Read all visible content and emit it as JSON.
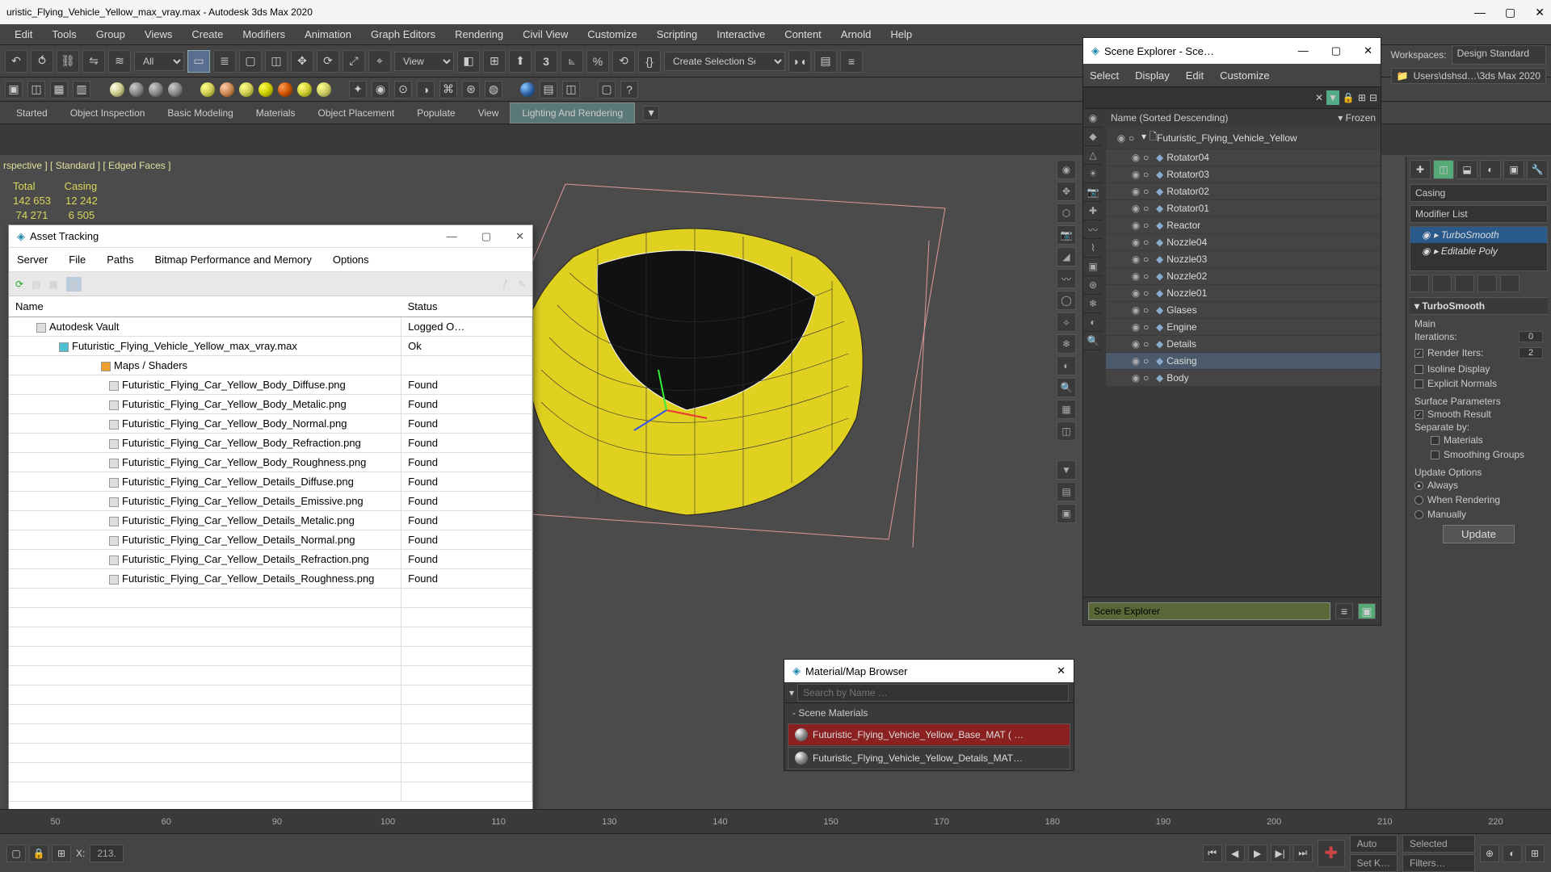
{
  "title_bar": "uristic_Flying_Vehicle_Yellow_max_vray.max - Autodesk 3ds Max 2020",
  "main_menu": [
    "Edit",
    "Tools",
    "Group",
    "Views",
    "Create",
    "Modifiers",
    "Animation",
    "Graph Editors",
    "Rendering",
    "Civil View",
    "Customize",
    "Scripting",
    "Interactive",
    "Content",
    "Arnold",
    "Help"
  ],
  "toolbar1": {
    "filter_drop": "All",
    "view_drop": "View",
    "selset_drop": "Create Selection Set"
  },
  "ribbon_tabs": [
    "Started",
    "Object Inspection",
    "Basic Modeling",
    "Materials",
    "Object Placement",
    "Populate",
    "View",
    "Lighting And Rendering"
  ],
  "ribbon_active": 7,
  "workspaces_label": "Workspaces:",
  "workspaces_value": "Design Standard",
  "path_bar": "Users\\dshsd…\\3ds Max 2020",
  "viewport": {
    "label": "rspective ] [ Standard ] [ Edged Faces ]",
    "stats_header": "Total          Casing",
    "stats_l1": "142 653     12 242",
    "stats_l2": " 74 271       6 505"
  },
  "asset_tracking": {
    "title": "Asset Tracking",
    "menu": [
      "Server",
      "File",
      "Paths",
      "Bitmap Performance and Memory",
      "Options"
    ],
    "col_name": "Name",
    "col_status": "Status",
    "rows": [
      {
        "indent": "indent1",
        "text": "Autodesk Vault",
        "status": "Logged O…",
        "ico": ""
      },
      {
        "indent": "indent2",
        "text": "Futuristic_Flying_Vehicle_Yellow_max_vray.max",
        "status": "Ok",
        "ico": "cyan"
      },
      {
        "indent": "indent3",
        "text": "Maps / Shaders",
        "status": "",
        "ico": "orange"
      },
      {
        "indent": "indent4",
        "text": "Futuristic_Flying_Car_Yellow_Body_Diffuse.png",
        "status": "Found",
        "ico": ""
      },
      {
        "indent": "indent4",
        "text": "Futuristic_Flying_Car_Yellow_Body_Metalic.png",
        "status": "Found",
        "ico": ""
      },
      {
        "indent": "indent4",
        "text": "Futuristic_Flying_Car_Yellow_Body_Normal.png",
        "status": "Found",
        "ico": ""
      },
      {
        "indent": "indent4",
        "text": "Futuristic_Flying_Car_Yellow_Body_Refraction.png",
        "status": "Found",
        "ico": ""
      },
      {
        "indent": "indent4",
        "text": "Futuristic_Flying_Car_Yellow_Body_Roughness.png",
        "status": "Found",
        "ico": ""
      },
      {
        "indent": "indent4",
        "text": "Futuristic_Flying_Car_Yellow_Details_Diffuse.png",
        "status": "Found",
        "ico": ""
      },
      {
        "indent": "indent4",
        "text": "Futuristic_Flying_Car_Yellow_Details_Emissive.png",
        "status": "Found",
        "ico": ""
      },
      {
        "indent": "indent4",
        "text": "Futuristic_Flying_Car_Yellow_Details_Metalic.png",
        "status": "Found",
        "ico": ""
      },
      {
        "indent": "indent4",
        "text": "Futuristic_Flying_Car_Yellow_Details_Normal.png",
        "status": "Found",
        "ico": ""
      },
      {
        "indent": "indent4",
        "text": "Futuristic_Flying_Car_Yellow_Details_Refraction.png",
        "status": "Found",
        "ico": ""
      },
      {
        "indent": "indent4",
        "text": "Futuristic_Flying_Car_Yellow_Details_Roughness.png",
        "status": "Found",
        "ico": ""
      }
    ]
  },
  "scene_explorer": {
    "title": "Scene Explorer - Sce…",
    "menu": [
      "Select",
      "Display",
      "Edit",
      "Customize"
    ],
    "header_name": "Name (Sorted Descending)",
    "header_frozen": "▾ Frozen",
    "root": "Futuristic_Flying_Vehicle_Yellow",
    "items": [
      "Rotator04",
      "Rotator03",
      "Rotator02",
      "Rotator01",
      "Reactor",
      "Nozzle04",
      "Nozzle03",
      "Nozzle02",
      "Nozzle01",
      "Glases",
      "Engine",
      "Details",
      "Casing",
      "Body"
    ],
    "selected_index": 12,
    "footer": "Scene Explorer"
  },
  "material_browser": {
    "title": "Material/Map Browser",
    "search_placeholder": "Search by Name …",
    "section": "Scene Materials",
    "items": [
      {
        "label": "Futuristic_Flying_Vehicle_Yellow_Base_MAT   ( …",
        "sel": true
      },
      {
        "label": "Futuristic_Flying_Vehicle_Yellow_Details_MAT…",
        "sel": false
      }
    ]
  },
  "command_panel": {
    "object_name": "Casing",
    "modifier_list_label": "Modifier List",
    "stack": [
      "TurboSmooth",
      "Editable Poly"
    ],
    "stack_sel": 0,
    "rollout_title": "TurboSmooth",
    "main_label": "Main",
    "iterations_label": "Iterations:",
    "iterations_value": "0",
    "render_iters_label": "Render Iters:",
    "render_iters_value": "2",
    "isoline": "Isoline Display",
    "explicit": "Explicit Normals",
    "surface_params": "Surface Parameters",
    "smooth_result": "Smooth Result",
    "separate_by": "Separate by:",
    "materials_chk": "Materials",
    "smoothing_groups": "Smoothing Groups",
    "update_options": "Update Options",
    "always": "Always",
    "when_rendering": "When Rendering",
    "manually": "Manually",
    "update_btn": "Update"
  },
  "statusbar": {
    "x_label": "X:",
    "x_value": "213.",
    "auto": "Auto",
    "selected": "Selected",
    "setk": "Set K…",
    "filters": "Filters…"
  },
  "timeline_ticks": [
    "50",
    "60",
    "90",
    "100",
    "110",
    "130",
    "140",
    "150",
    "170",
    "180",
    "190",
    "200",
    "210",
    "220"
  ]
}
